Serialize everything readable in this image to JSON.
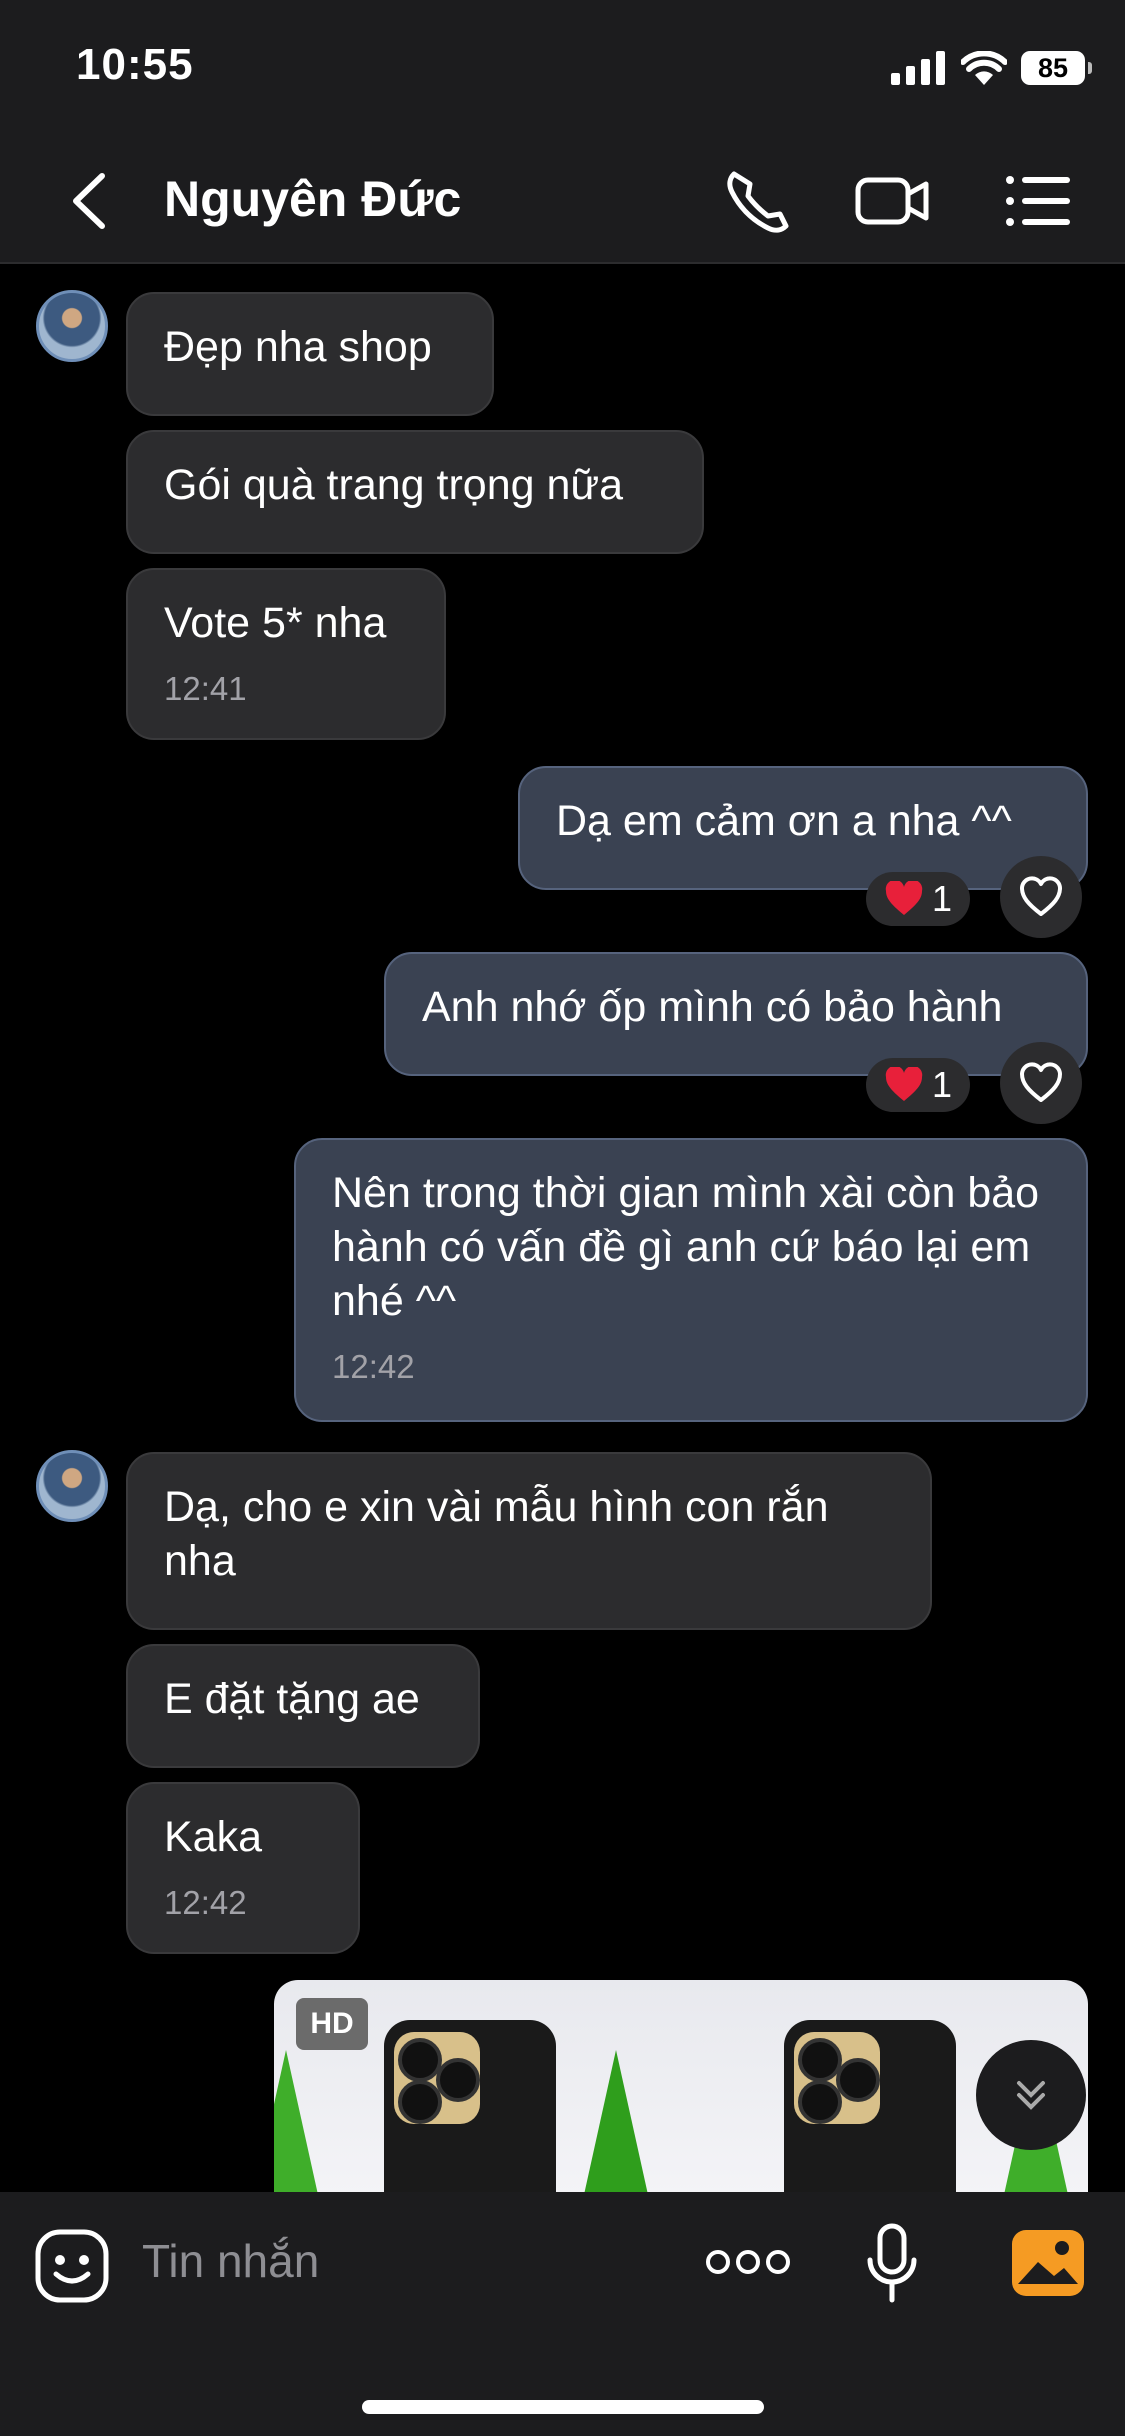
{
  "status_bar": {
    "time": "10:55",
    "battery": "85"
  },
  "header": {
    "title": "Nguyên Đức"
  },
  "messages": [
    {
      "text": "Đẹp nha shop"
    },
    {
      "text": "Gói quà trang trọng nữa"
    },
    {
      "text": "Vote 5* nha",
      "time": "12:41"
    },
    {
      "text": "Dạ em cảm ơn a nha ^^",
      "reaction_count": "1"
    },
    {
      "text": "Anh nhớ ốp mình có bảo hành",
      "reaction_count": "1"
    },
    {
      "text": "Nên trong thời gian mình xài còn bảo hành có vấn đề gì anh cứ báo lại em nhé ^^",
      "time": "12:42"
    },
    {
      "text": "Dạ, cho e xin vài mẫu hình con rắn nha"
    },
    {
      "text": "E đặt tặng ae"
    },
    {
      "text": "Kaka",
      "time": "12:42"
    }
  ],
  "photo": {
    "badge": "HD"
  },
  "input": {
    "placeholder": "Tin nhắn"
  },
  "colors": {
    "incoming_bubble": "#2c2c2e",
    "outgoing_bubble": "#3a4252",
    "photo_button_accent": "#f59b23",
    "heart": "#e8203a"
  }
}
